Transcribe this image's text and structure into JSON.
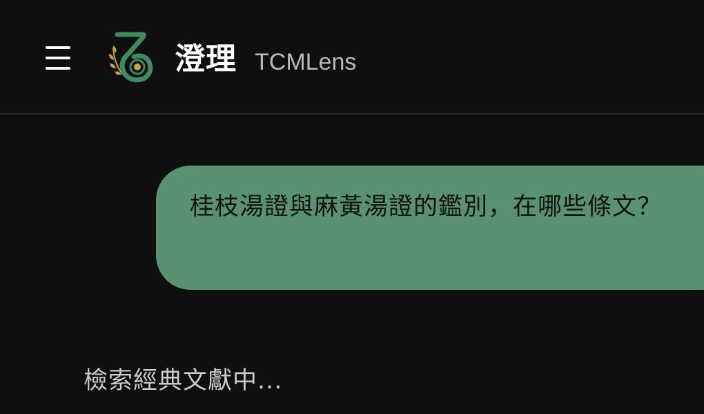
{
  "header": {
    "menu_icon": "hamburger-menu-icon",
    "logo_icon": "tcmlens-logo-icon",
    "app_name": "澄理",
    "app_subtitle": "TCMLens"
  },
  "chat": {
    "user_message": "桂枝湯證與麻黃湯證的鑑別，在哪些條文？",
    "status": "檢索經典文獻中..."
  },
  "colors": {
    "background": "#0e0f0e",
    "accent_green": "#5a9170",
    "logo_green": "#3f8a5e",
    "logo_gold": "#c9a24a",
    "divider": "#2a2c2a"
  }
}
